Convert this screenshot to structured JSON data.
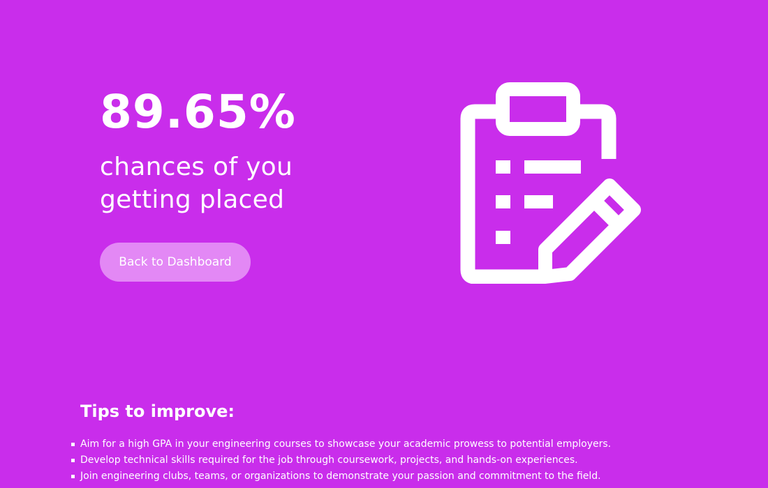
{
  "result": {
    "percentage": "89.65%",
    "subtitle_line1": "chances of you",
    "subtitle_line2": "getting placed"
  },
  "actions": {
    "back_label": "Back to Dashboard"
  },
  "illustration": {
    "icon": "clipboard-edit-icon"
  },
  "tips": {
    "heading": "Tips to improve:",
    "items": [
      "Aim for a high GPA in your engineering courses to showcase your academic prowess to potential employers.",
      "Develop technical skills required for the job through coursework, projects, and hands-on experiences.",
      "Join engineering clubs, teams, or organizations to demonstrate your passion and commitment to the field."
    ]
  },
  "colors": {
    "background": "#c92deb",
    "button": "#e388f5",
    "text": "#ffffff"
  }
}
